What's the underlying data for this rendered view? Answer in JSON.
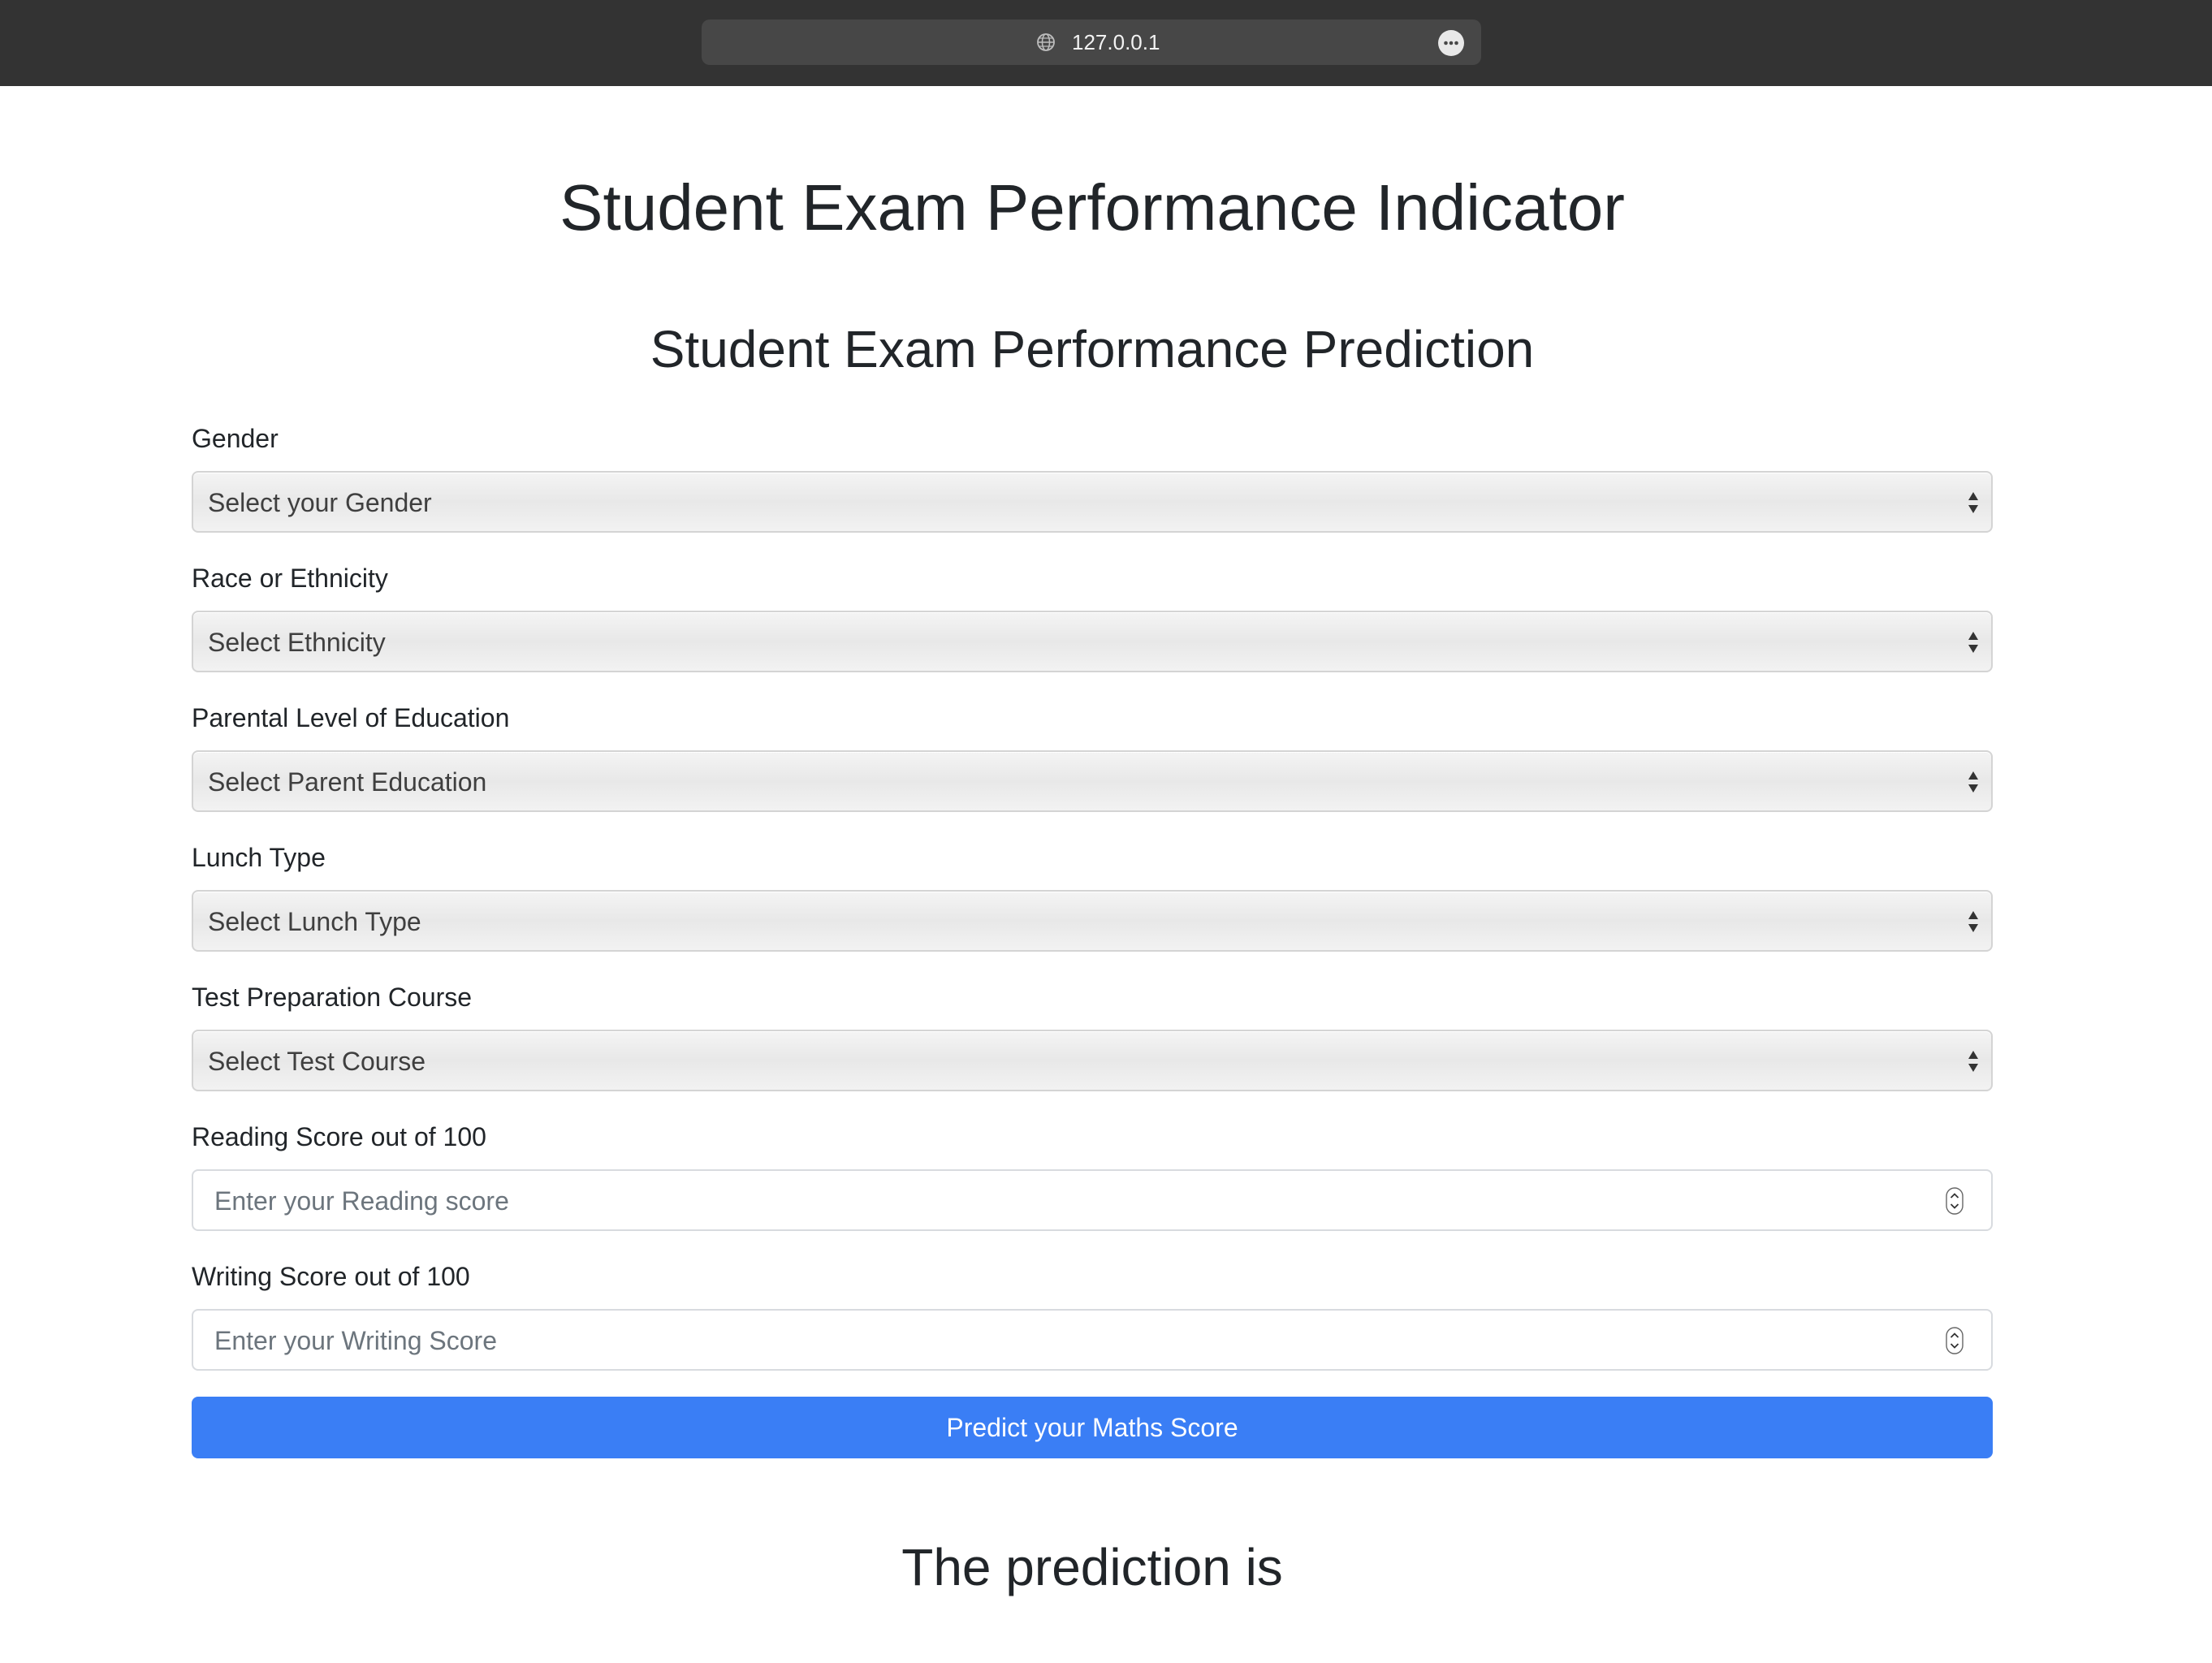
{
  "browser": {
    "url": "127.0.0.1"
  },
  "page": {
    "title": "Student Exam Performance Indicator",
    "form_title": "Student Exam Performance Prediction",
    "fields": {
      "gender": {
        "label": "Gender",
        "selected": "Select your Gender"
      },
      "ethnicity": {
        "label": "Race or Ethnicity",
        "selected": "Select Ethnicity"
      },
      "parental_education": {
        "label": "Parental Level of Education",
        "selected": "Select Parent Education"
      },
      "lunch": {
        "label": "Lunch Type",
        "selected": "Select Lunch Type"
      },
      "test_course": {
        "label": "Test Preparation Course",
        "selected": "Select Test Course"
      },
      "reading_score": {
        "label": "Reading Score out of 100",
        "placeholder": "Enter your Reading score"
      },
      "writing_score": {
        "label": "Writing Score out of 100",
        "placeholder": "Enter your Writing Score"
      }
    },
    "submit_label": "Predict your Maths Score",
    "result_label": "The prediction is"
  },
  "colors": {
    "browser_bar": "#333333",
    "accent": "#3a7ef5"
  }
}
